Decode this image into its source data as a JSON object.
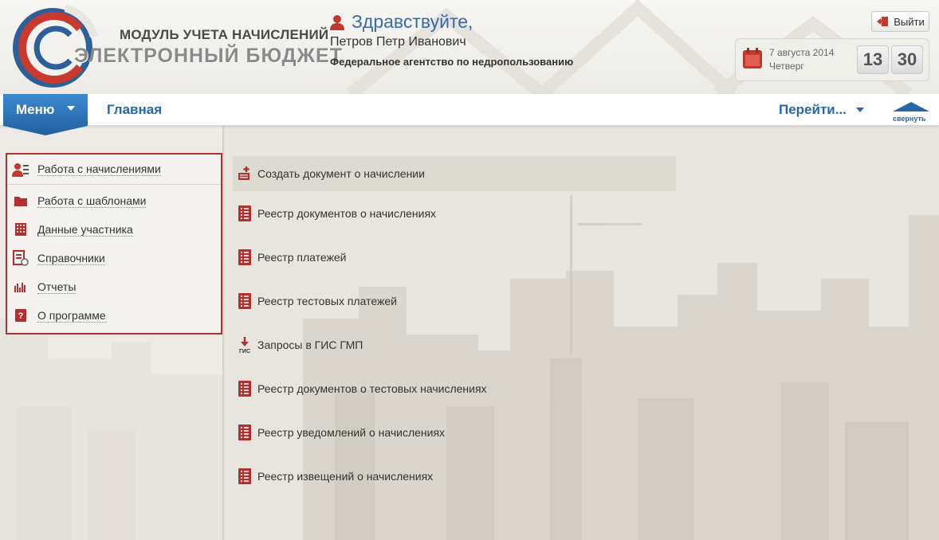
{
  "header": {
    "brand_top": "МОДУЛЬ УЧЕТА НАЧИСЛЕНИЙ",
    "brand_bottom": "ЭЛЕКТРОННЫЙ БЮДЖЕТ",
    "greeting": "Здравствуйте,",
    "user_name": "Петров Петр Иванович",
    "organization": "Федеральное агентство по недропользованию",
    "logout_label": "Выйти",
    "date": "7 августа 2014",
    "weekday": "Четверг",
    "time_hours": "13",
    "time_minutes": "30"
  },
  "nav": {
    "menu_label": "Меню",
    "home_label": "Главная",
    "goto_label": "Перейти...",
    "collapse_label": "свернуть"
  },
  "left_menu": {
    "items": [
      {
        "label": "Работа с начислениями",
        "icon": "accruals-user-icon"
      },
      {
        "label": "Работа с шаблонами",
        "icon": "folder-icon"
      },
      {
        "label": "Данные участника",
        "icon": "building-icon"
      },
      {
        "label": "Справочники",
        "icon": "reference-book-icon"
      },
      {
        "label": "Отчеты",
        "icon": "bar-chart-icon"
      },
      {
        "label": "О программе",
        "icon": "help-book-icon"
      }
    ]
  },
  "content": {
    "items": [
      {
        "label": "Создать документ о начислении",
        "icon": "create-document-icon"
      },
      {
        "label": "Реестр документов о начислениях",
        "icon": "registry-icon"
      },
      {
        "label": "Реестр платежей",
        "icon": "registry-icon"
      },
      {
        "label": "Реестр тестовых платежей",
        "icon": "registry-icon"
      },
      {
        "label": "Запросы в ГИС ГМП",
        "icon": "gis-download-icon"
      },
      {
        "label": "Реестр документов о тестовых начислениях",
        "icon": "registry-icon"
      },
      {
        "label": "Реестр уведомлений о начислениях",
        "icon": "registry-icon"
      },
      {
        "label": "Реестр извещений о начислениях",
        "icon": "registry-icon"
      }
    ]
  },
  "colors": {
    "accent_blue": "#2a67a6",
    "menu_blue": "#2f78b6",
    "highlight_red": "#b23030",
    "icon_red": "#c0392b"
  }
}
